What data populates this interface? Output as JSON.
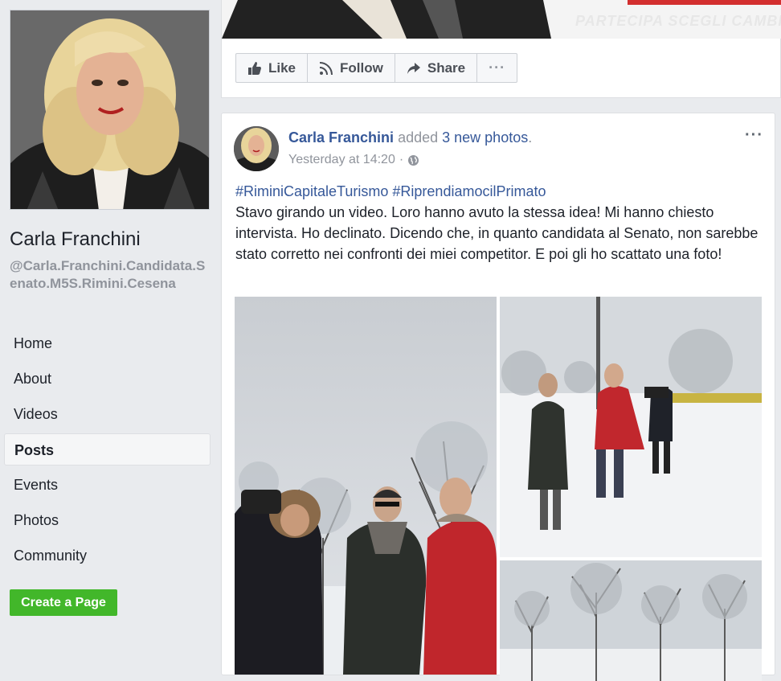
{
  "page": {
    "name": "Carla Franchini",
    "handle": "@Carla.Franchini.Candidata.Senato.M5S.Rimini.Cesena"
  },
  "nav": {
    "items": [
      {
        "label": "Home"
      },
      {
        "label": "About"
      },
      {
        "label": "Videos"
      },
      {
        "label": "Posts"
      },
      {
        "label": "Events"
      },
      {
        "label": "Photos"
      },
      {
        "label": "Community"
      }
    ],
    "active": "Posts"
  },
  "create_page_label": "Create a Page",
  "actions": {
    "like": "Like",
    "follow": "Follow",
    "share": "Share",
    "more": "···"
  },
  "cover_text": "PARTECIPA SCEGLI CAMBIA",
  "post": {
    "author": "Carla Franchini",
    "verb": "added",
    "photos_link": "3 new photos",
    "period": ".",
    "time": "Yesterday at 14:20",
    "separator": "·",
    "menu": "···",
    "hashtag1": "#RiminiCapitaleTurismo",
    "hashtag2": "#RiprendiamocilPrimato",
    "body": "Stavo girando un video. Loro hanno avuto la stessa idea! Mi hanno chiesto intervista. Ho declinato. Dicendo che, in quanto candidata al Senato, non sarebbe stato corretto nei confronti dei miei competitor. E poi gli ho scattato una foto!"
  },
  "colors": {
    "link": "#365899",
    "green": "#42b72a",
    "background": "#e9ebee"
  }
}
